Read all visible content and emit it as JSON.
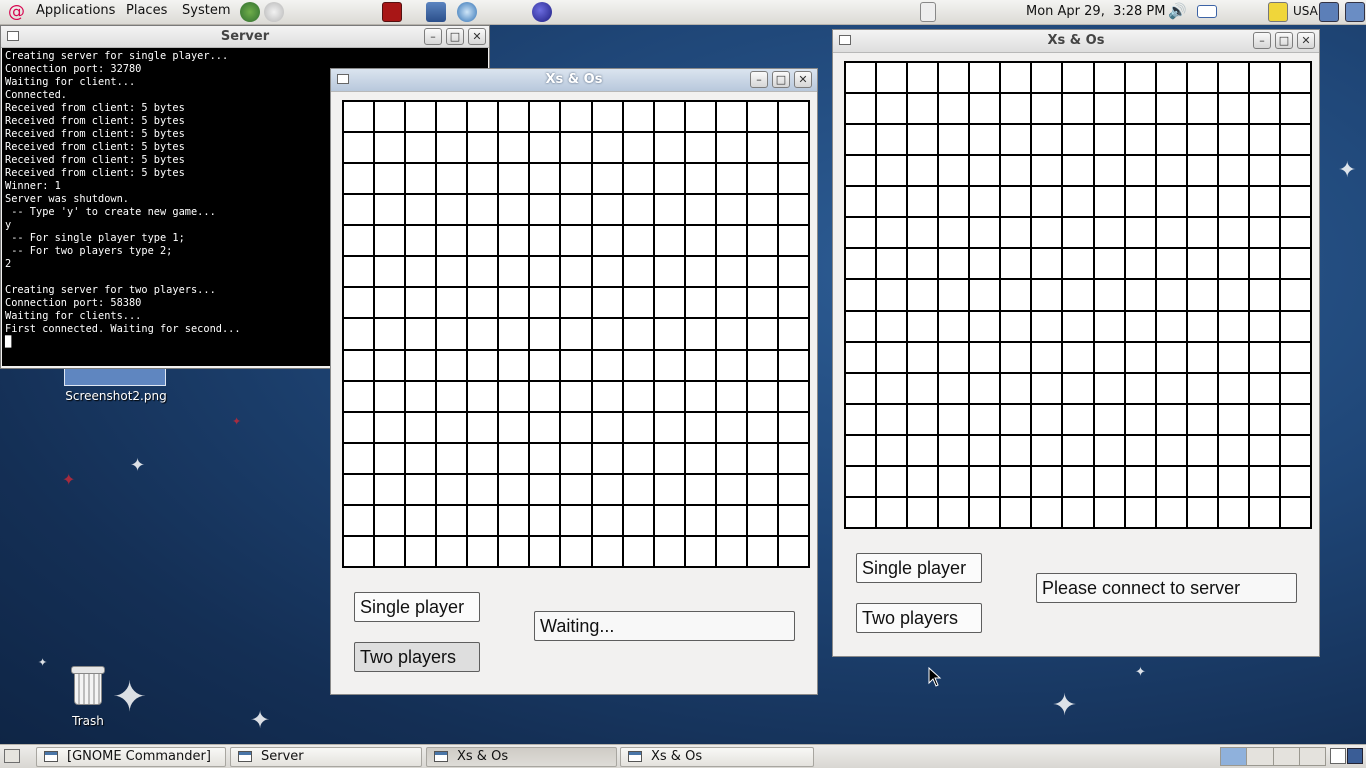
{
  "top_panel": {
    "menus": [
      "Applications",
      "Places",
      "System"
    ],
    "clock": "Mon Apr 29,  3:28 PM",
    "keyboard_layout": "USA"
  },
  "desktop": {
    "screenshot_label": "Screenshot2.png",
    "trash_label": "Trash"
  },
  "server_window": {
    "title": "Server",
    "lines": [
      "Creating server for single player...",
      "Connection port: 32780",
      "Waiting for client...",
      "Connected.",
      "Received from client: 5 bytes",
      "Received from client: 5 bytes",
      "Received from client: 5 bytes",
      "Received from client: 5 bytes",
      "Received from client: 5 bytes",
      "Received from client: 5 bytes",
      "Winner: 1",
      "Server was shutdown.",
      " -- Type 'y' to create new game...",
      "y",
      " -- For single player type 1;",
      " -- For two players type 2;",
      "2",
      "",
      "Creating server for two players...",
      "Connection port: 58380",
      "Waiting for clients...",
      "First connected. Waiting for second...",
      "█"
    ]
  },
  "game_window_1": {
    "title": "Xs & Os",
    "single_player_label": "Single player",
    "two_players_label": "Two players",
    "status": "Waiting...",
    "grid_size": 15
  },
  "game_window_2": {
    "title": "Xs & Os",
    "single_player_label": "Single player",
    "two_players_label": "Two players",
    "status": "Please connect to server",
    "grid_size": 15
  },
  "taskbar": {
    "items": [
      "[GNOME Commander]",
      "Server",
      "Xs & Os",
      "Xs & Os"
    ]
  },
  "colors": {
    "desktop_background": "#1f4677",
    "active_titlebar": "#b8c8dc",
    "terminal_background": "#000000"
  }
}
